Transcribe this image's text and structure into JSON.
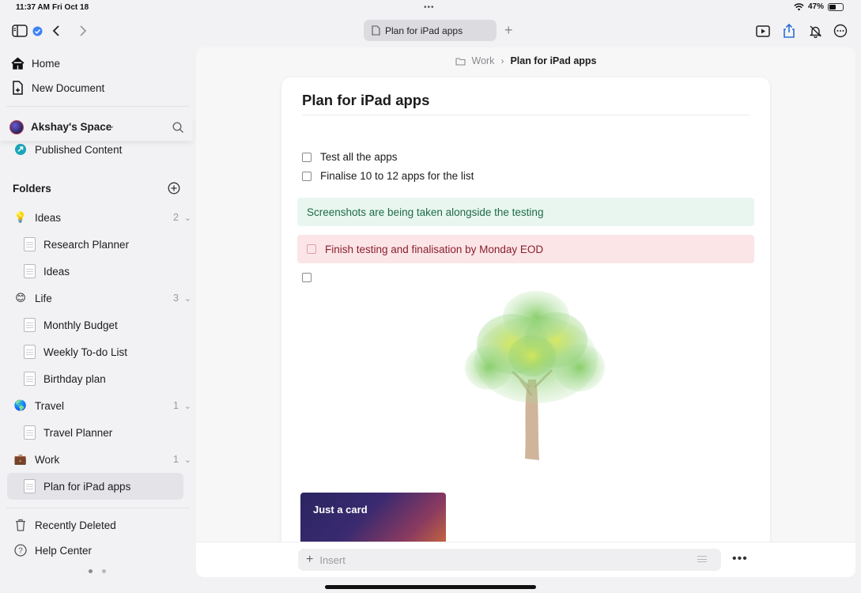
{
  "status_bar": {
    "time": "11:37 AM",
    "date": "Fri Oct 18",
    "battery_text": "47%",
    "battery_level": 0.47
  },
  "toolbar": {
    "tab_title": "Plan for iPad apps",
    "new_tab_label": "+"
  },
  "sidebar": {
    "home": "Home",
    "new_document": "New Document",
    "space_name": "Akshay's Space",
    "published": "Published Content",
    "folders_heading": "Folders",
    "folders": [
      {
        "icon": "💡",
        "name": "Ideas",
        "count": "2",
        "children": [
          "Research Planner",
          "Ideas"
        ]
      },
      {
        "icon": "😊",
        "name": "Life",
        "count": "3",
        "children": [
          "Monthly Budget",
          "Weekly To-do List",
          "Birthday plan"
        ]
      },
      {
        "icon": "🌎",
        "name": "Travel",
        "count": "1",
        "children": [
          "Travel Planner"
        ]
      },
      {
        "icon": "💼",
        "name": "Work",
        "count": "1",
        "children": [
          "Plan for iPad apps"
        ]
      }
    ],
    "recently_deleted": "Recently Deleted",
    "help_center": "Help Center"
  },
  "breadcrumb": {
    "folder": "Work",
    "current": "Plan for iPad apps"
  },
  "document": {
    "title": "Plan for iPad apps",
    "checklist": [
      "Test all the apps",
      "Finalise 10 to 12 apps for the list"
    ],
    "green_callout": "Screenshots are being taken alongside the testing",
    "red_callout": "Finish testing and finalisation by Monday EOD",
    "card_title": "Just a card"
  },
  "bottom_bar": {
    "insert_placeholder": "Insert",
    "more_label": "•••"
  },
  "colors": {
    "accent_blue": "#3b82f6",
    "green_callout_bg": "#e9f6f0",
    "red_callout_bg": "#fbe5e7"
  }
}
